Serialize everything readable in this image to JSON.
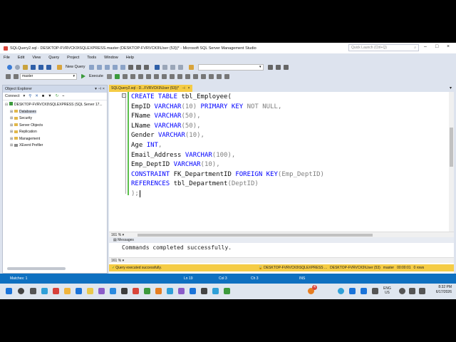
{
  "window": {
    "title": "SQLQuery2.sql - DESKTOP-FVRVCK9\\SQLEXPRESS.master (DESKTOP-FVRVCK9\\User (53))* - Microsoft SQL Server Management Studio",
    "quick_launch_placeholder": "Quick Launch (Ctrl+Q)"
  },
  "menu": [
    "File",
    "Edit",
    "View",
    "Query",
    "Project",
    "Tools",
    "Window",
    "Help"
  ],
  "toolbar": {
    "new_query": "New Query",
    "database": "master",
    "execute": "Execute"
  },
  "object_explorer": {
    "title": "Object Explorer",
    "connect": "Connect",
    "server": "DESKTOP-FVRVCK9\\SQLEXPRESS (SQL Server 17...",
    "nodes": [
      "Databases",
      "Security",
      "Server Objects",
      "Replication",
      "Management",
      "XEvent Profiler"
    ]
  },
  "tab": {
    "label": "SQLQuery2.sql - D...FVRVCK9\\User (53))*"
  },
  "editor": {
    "zoom": "161 %",
    "lines": [
      [
        {
          "t": "CREATE TABLE ",
          "c": "kw"
        },
        {
          "t": "tbl_Employee(",
          "c": "tx"
        }
      ],
      [
        {
          "t": "EmpID ",
          "c": "tx"
        },
        {
          "t": "VARCHAR",
          "c": "kw"
        },
        {
          "t": "(10) ",
          "c": "gr"
        },
        {
          "t": "PRIMARY KEY ",
          "c": "kw"
        },
        {
          "t": "NOT NULL",
          "c": "gr"
        },
        {
          "t": ",",
          "c": "gr"
        }
      ],
      [
        {
          "t": "FName ",
          "c": "tx"
        },
        {
          "t": "VARCHAR",
          "c": "kw"
        },
        {
          "t": "(50),",
          "c": "gr"
        }
      ],
      [
        {
          "t": "LName ",
          "c": "tx"
        },
        {
          "t": "VARCHAR",
          "c": "kw"
        },
        {
          "t": "(50),",
          "c": "gr"
        }
      ],
      [
        {
          "t": "Gender ",
          "c": "tx"
        },
        {
          "t": "VARCHAR",
          "c": "kw"
        },
        {
          "t": "(10),",
          "c": "gr"
        }
      ],
      [
        {
          "t": "Age ",
          "c": "tx"
        },
        {
          "t": "INT",
          "c": "kw"
        },
        {
          "t": ",",
          "c": "gr"
        }
      ],
      [
        {
          "t": "Email_Address ",
          "c": "tx"
        },
        {
          "t": "VARCHAR",
          "c": "kw"
        },
        {
          "t": "(100),",
          "c": "gr"
        }
      ],
      [
        {
          "t": "Emp_DeptID ",
          "c": "tx"
        },
        {
          "t": "VARCHAR",
          "c": "kw"
        },
        {
          "t": "(10),",
          "c": "gr"
        }
      ],
      [
        {
          "t": "CONSTRAINT ",
          "c": "kw"
        },
        {
          "t": "FK_DepartmentID ",
          "c": "tx"
        },
        {
          "t": "FOREIGN KEY",
          "c": "kw"
        },
        {
          "t": "(Emp_DeptID)",
          "c": "gr"
        }
      ],
      [
        {
          "t": "REFERENCES ",
          "c": "kw"
        },
        {
          "t": "tbl_Department",
          "c": "tx"
        },
        {
          "t": "(DeptID)",
          "c": "gr"
        }
      ],
      [
        {
          "t": ");",
          "c": "gr"
        }
      ]
    ]
  },
  "messages": {
    "tab": "Messages",
    "text": "Commands completed successfully.",
    "zoom": "161 %"
  },
  "query_status": {
    "left": "Query executed successfully.",
    "server": "DESKTOP-FVRVCK9\\SQLEXPRESS ...",
    "user": "DESKTOP-FVRVCK9\\User (53)",
    "db": "master",
    "time": "00:00:01",
    "rows": "0 rows"
  },
  "statusbar": {
    "left": "Matches: 1",
    "ln": "Ln 19",
    "col": "Col 3",
    "ch": "Ch 3",
    "ins": "INS"
  },
  "taskbar": {
    "lang1": "ENG",
    "lang2": "US",
    "time": "8:32 PM",
    "date": "6/17/2026",
    "badge": "4"
  },
  "colors": {
    "accent": "#0e70c0",
    "tab_active": "#f5cc45",
    "keyword": "#0000ff"
  }
}
